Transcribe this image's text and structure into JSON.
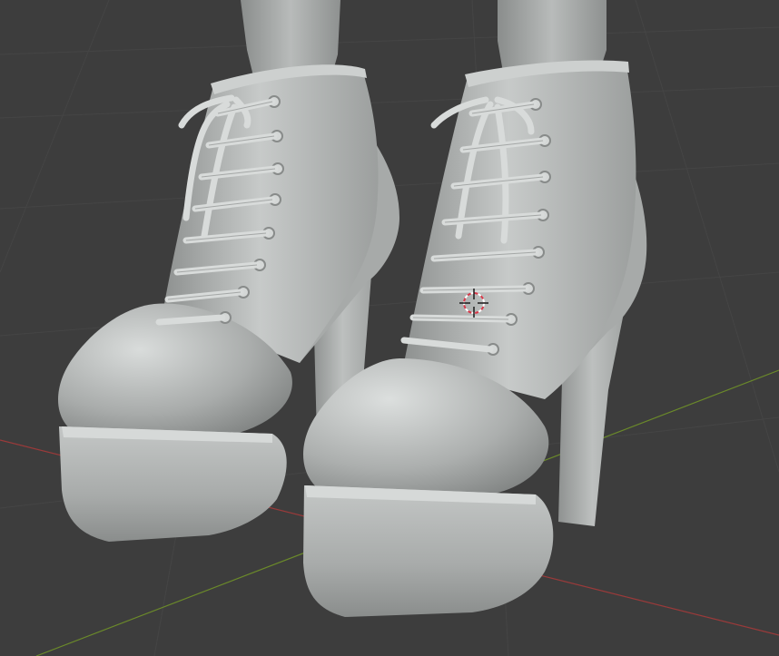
{
  "viewport": {
    "background": "#3d3d3d",
    "grid_color": "#454545",
    "x_axis_color": "#9a3a3a",
    "y_axis_color": "#6b8a2a",
    "cursor_color": "#d8394a"
  },
  "model": {
    "base_color": "#b9bcbb",
    "highlight_color": "#dfe2e1",
    "shadow_color": "#7a7d7c"
  }
}
